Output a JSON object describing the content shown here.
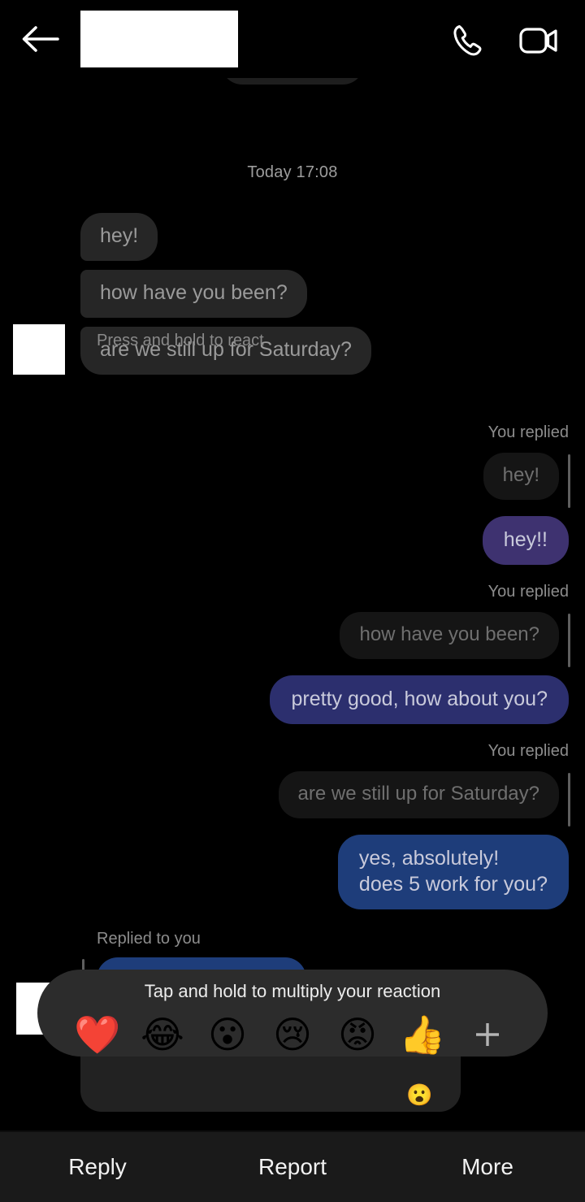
{
  "header": {
    "back_icon": "back-arrow-icon",
    "contact_name_redacted": "",
    "call_icon": "phone-call-icon",
    "video_icon": "video-call-icon"
  },
  "conversation": {
    "day_divider": "Today 17:08",
    "incoming_messages": [
      {
        "text": "hey!"
      },
      {
        "text": "how have you been?"
      },
      {
        "text": "are we still up for Saturday?"
      }
    ],
    "react_hint": "Press and hold to react",
    "reply_groups": [
      {
        "label": "You replied",
        "quote": "hey!",
        "reply": "hey!!",
        "bubble_color": "#3E3270"
      },
      {
        "label": "You replied",
        "quote": "how have you been?",
        "reply": "pretty good, how about you?",
        "bubble_color": "#2C2F6E"
      },
      {
        "label": "You replied",
        "quote": "are we still up for Saturday?",
        "reply": "yes, absolutely!\ndoes 5 work for you?",
        "bubble_color": "#1E3D7A"
      }
    ],
    "incoming_reply_group": {
      "label": "Replied to you",
      "quote_bubble_color": "#1E3D7A",
      "reaction": "😮"
    }
  },
  "reaction_picker": {
    "title": "Tap and hold to multiply your reaction",
    "emojis": [
      {
        "name": "heart-reaction",
        "glyph": "❤️"
      },
      {
        "name": "laughing-reaction",
        "glyph": "😂"
      },
      {
        "name": "surprised-reaction",
        "glyph": "😮"
      },
      {
        "name": "sad-reaction",
        "glyph": "😢"
      },
      {
        "name": "angry-reaction",
        "glyph": "😡"
      },
      {
        "name": "thumbs-up-reaction",
        "glyph": "👍"
      }
    ],
    "add_label": "+"
  },
  "action_bar": {
    "items": [
      {
        "label": "Reply"
      },
      {
        "label": "Report"
      },
      {
        "label": "More"
      }
    ]
  },
  "colors": {
    "background": "#000000",
    "incoming_bubble": "#262626",
    "quoted_bubble": "#151515",
    "picker_background": "#2c2c2c",
    "action_bar": "#1a1a1a"
  }
}
